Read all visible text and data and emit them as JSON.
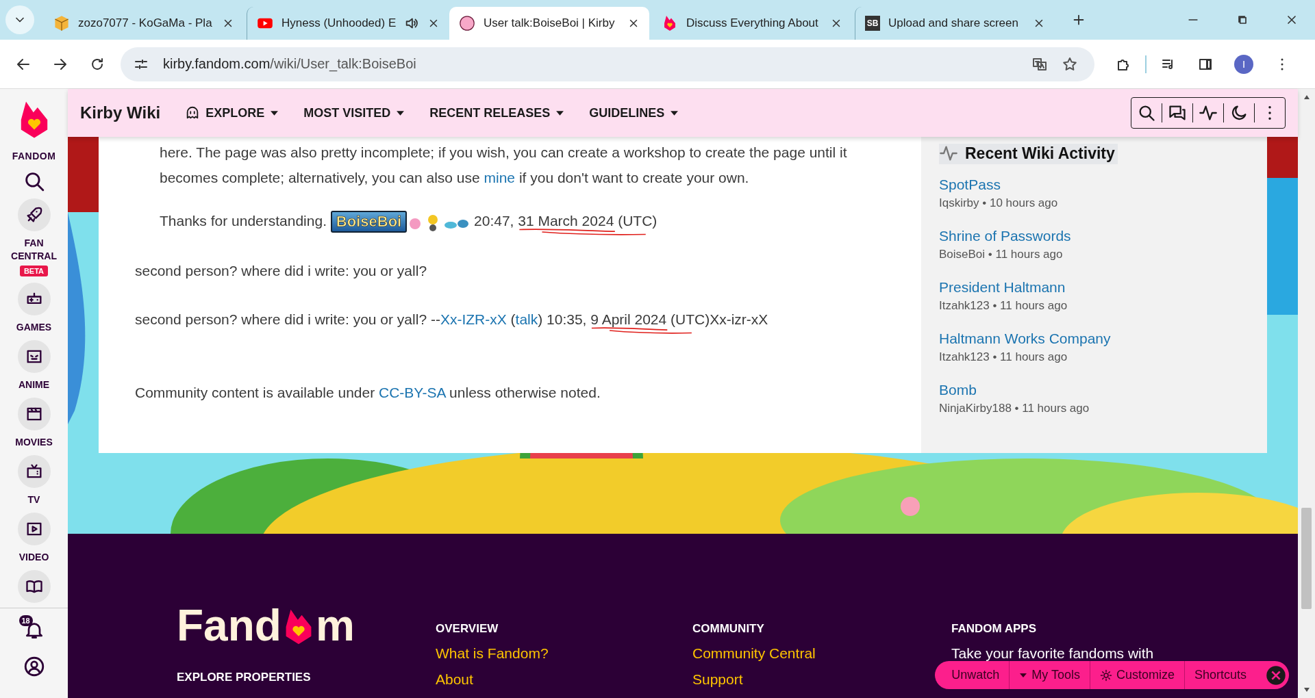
{
  "browser": {
    "tabs": [
      {
        "title": "zozo7077 - KoGaMa - Pla",
        "selected": false,
        "audio": false
      },
      {
        "title": "Hyness (Unhooded) E",
        "selected": false,
        "audio": true
      },
      {
        "title": "User talk:BoiseBoi | Kirby",
        "selected": true,
        "audio": false
      },
      {
        "title": "Discuss Everything About",
        "selected": false,
        "audio": false
      },
      {
        "title": "Upload and share screen",
        "selected": false,
        "audio": false,
        "favicon_text": "SB"
      }
    ],
    "address": {
      "host": "kirby.fandom.com",
      "path": "/wiki/User_talk:BoiseBoi"
    },
    "profile_initial": "I"
  },
  "fandom_rail": {
    "brand": "FANDOM",
    "items": [
      {
        "label": "FAN CENTRAL",
        "badge": "BETA"
      },
      {
        "label": "GAMES"
      },
      {
        "label": "ANIME"
      },
      {
        "label": "MOVIES"
      },
      {
        "label": "TV"
      },
      {
        "label": "VIDEO"
      }
    ],
    "notification_count": "18"
  },
  "wiki_nav": {
    "title": "Kirby Wiki",
    "menus": [
      "EXPLORE",
      "MOST VISITED",
      "RECENT RELEASES",
      "GUIDELINES"
    ]
  },
  "talk": {
    "lines": [
      {
        "indented": true,
        "segments": [
          {
            "kind": "text",
            "text": "here. The page was also pretty incomplete; if you wish, you can create a workshop to create the page until it"
          }
        ]
      },
      {
        "indented": true,
        "segments": [
          {
            "kind": "text",
            "text": "becomes complete; alternatively, you can also use "
          },
          {
            "kind": "link",
            "text": "mine"
          },
          {
            "kind": "text",
            "text": " if you don't want to create your own."
          }
        ]
      },
      {
        "indented": true,
        "segments": [
          {
            "kind": "text",
            "text": "Thanks for understanding. "
          },
          {
            "kind": "signature",
            "text": "BoiseBoi"
          },
          {
            "kind": "text",
            "text": " 20:47, "
          },
          {
            "kind": "text",
            "text": "31 March 2024",
            "scribbled": true
          },
          {
            "kind": "text",
            "text": " (UTC)"
          }
        ]
      },
      {
        "indented": false,
        "segments": [
          {
            "kind": "text",
            "text": "second person? where did i write: you or yall?"
          }
        ]
      },
      {
        "indented": false,
        "segments": [
          {
            "kind": "text",
            "text": "second person? where did i write: you or yall? --"
          },
          {
            "kind": "link",
            "text": "Xx-IZR-xX"
          },
          {
            "kind": "text",
            "text": " ("
          },
          {
            "kind": "link",
            "text": "talk"
          },
          {
            "kind": "text",
            "text": ") 10:35, "
          },
          {
            "kind": "text",
            "text": "9 April 2024",
            "scribbled": true
          },
          {
            "kind": "text",
            "text": " (UTC)Xx-izr-xX"
          }
        ]
      },
      {
        "indented": false,
        "segments": [
          {
            "kind": "text",
            "text": "Community content is available under "
          },
          {
            "kind": "link",
            "text": "CC-BY-SA"
          },
          {
            "kind": "text",
            "text": " unless otherwise noted."
          }
        ]
      }
    ]
  },
  "activity": {
    "title": "Recent Wiki Activity",
    "items": [
      {
        "page": "SpotPass",
        "meta": "Iqskirby • 10 hours ago"
      },
      {
        "page": "Shrine of Passwords",
        "meta": "BoiseBoi • 11 hours ago"
      },
      {
        "page": "President Haltmann",
        "meta": "Itzahk123 • 11 hours ago"
      },
      {
        "page": "Haltmann Works Company",
        "meta": "Itzahk123 • 11 hours ago"
      },
      {
        "page": "Bomb",
        "meta": "NinjaKirby188 • 11 hours ago"
      }
    ]
  },
  "footer": {
    "logo": [
      "Fand",
      "m"
    ],
    "explore": "EXPLORE PROPERTIES",
    "columns": [
      {
        "heading": "OVERVIEW",
        "links": [
          "What is Fandom?",
          "About"
        ]
      },
      {
        "heading": "COMMUNITY",
        "links": [
          "Community Central",
          "Support"
        ]
      },
      {
        "heading": "FANDOM APPS",
        "text": "Take your favorite fandoms with"
      }
    ]
  },
  "tools_bar": {
    "items": [
      "Unwatch",
      "My Tools",
      "Customize",
      "Shortcuts"
    ]
  }
}
